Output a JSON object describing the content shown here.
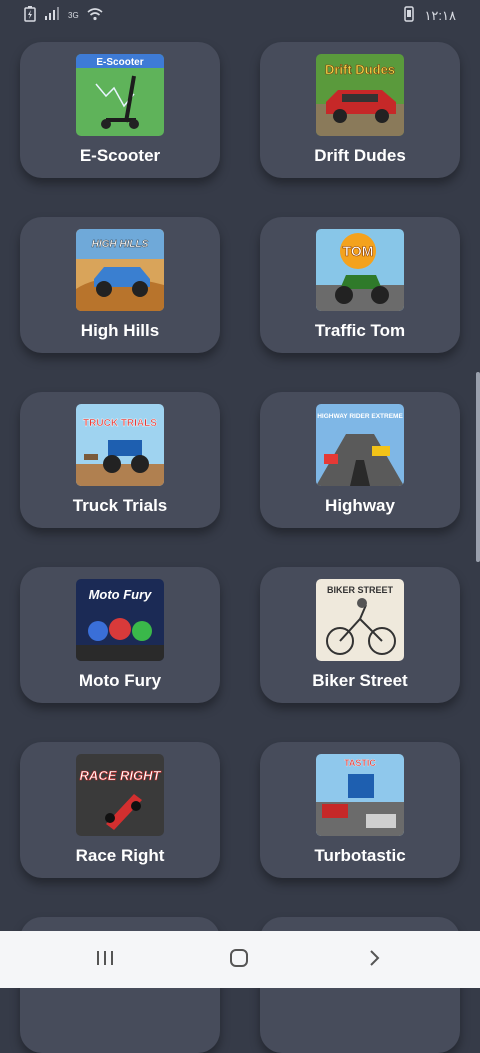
{
  "status_bar": {
    "time": "١٢:١٨",
    "network": "3G",
    "icons": [
      "battery-icon",
      "signal-icon",
      "wifi-icon",
      "phone-icon"
    ]
  },
  "games": [
    {
      "name": "E-Scooter",
      "thumb_text": "E-Scooter"
    },
    {
      "name": "Drift Dudes",
      "thumb_text": "Drift Dudes"
    },
    {
      "name": "High Hills",
      "thumb_text": "HIGH HILLS"
    },
    {
      "name": "Traffic Tom",
      "thumb_text": "TOM"
    },
    {
      "name": "Truck Trials",
      "thumb_text": "TRUCK TRIALS"
    },
    {
      "name": "Highway",
      "thumb_text": "HIGHWAY RIDER EXTREME"
    },
    {
      "name": "Moto Fury",
      "thumb_text": "Moto Fury"
    },
    {
      "name": "Biker Street",
      "thumb_text": "BIKER STREET"
    },
    {
      "name": "Race Right",
      "thumb_text": "RACE RIGHT"
    },
    {
      "name": "Turbotastic",
      "thumb_text": "TASTIC"
    }
  ],
  "nav_bar": {
    "icons": [
      "recent-apps-icon",
      "home-icon",
      "back-icon"
    ]
  },
  "colors": {
    "background": "#363b48",
    "card": "#474c5b",
    "text": "#ffffff"
  }
}
